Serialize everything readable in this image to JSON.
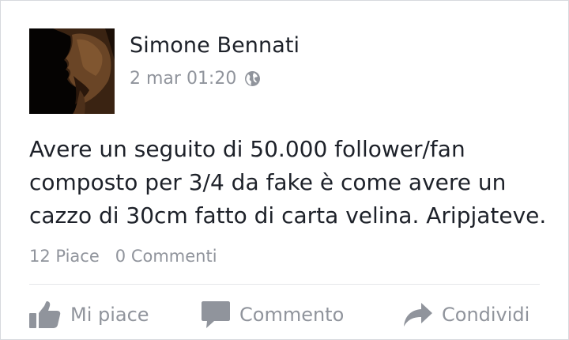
{
  "post": {
    "author": "Simone Bennati",
    "timestamp": "2 mar 01:20",
    "privacy_icon": "globe-icon",
    "text": "Avere un seguito di 50.000 follower/fan composto per 3/4 da fake è come avere un cazzo di 30cm fatto di carta velina. Aripjateve."
  },
  "stats": {
    "likes": "12 Piace",
    "comments": "0 Commenti"
  },
  "actions": {
    "like_label": "Mi piace",
    "comment_label": "Commento",
    "share_label": "Condividi"
  },
  "colors": {
    "text": "#1d2129",
    "muted": "#90949c",
    "divider": "#e5e6e9"
  }
}
